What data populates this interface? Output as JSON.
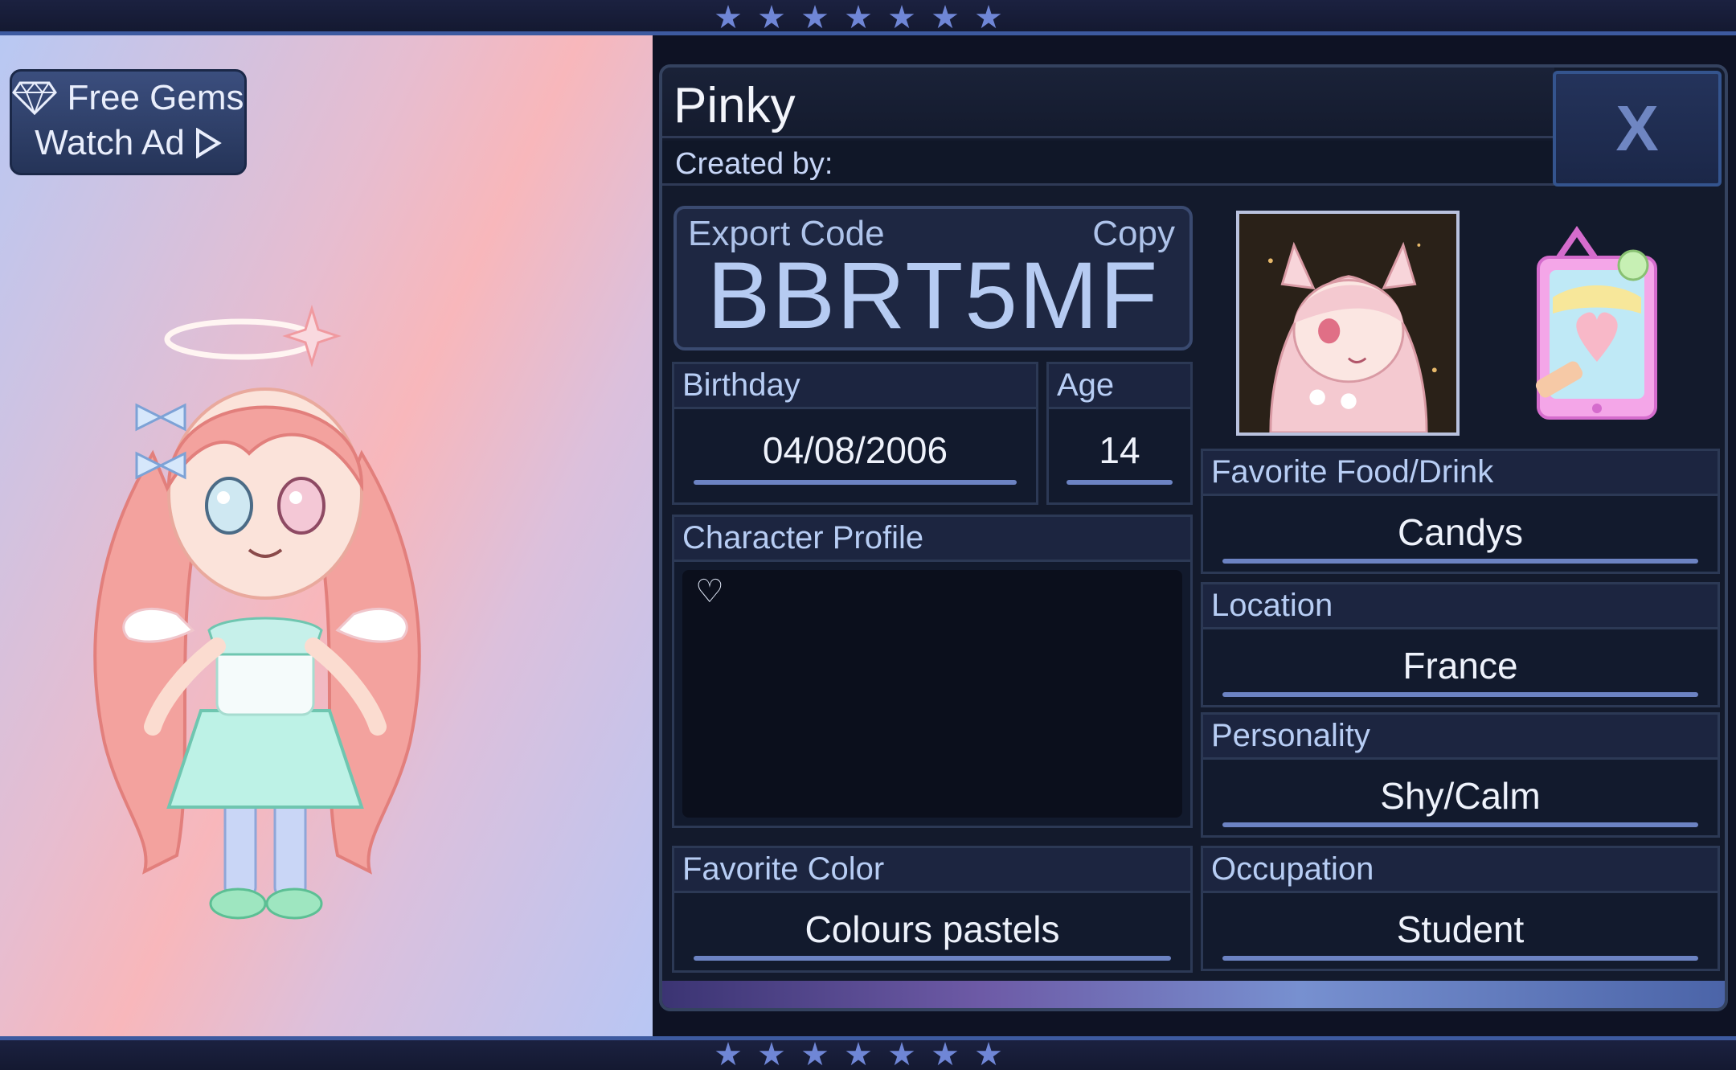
{
  "preview": {
    "free_gems_label": "Free Gems",
    "watch_ad_label": "Watch Ad"
  },
  "profile": {
    "name": "Pinky",
    "created_by_label": "Created by:",
    "close_label": "X",
    "export_code_label": "Export Code",
    "copy_label": "Copy",
    "export_code": "BBRT5MF",
    "birthday_label": "Birthday",
    "birthday": "04/08/2006",
    "age_label": "Age",
    "age": "14",
    "character_profile_label": "Character Profile",
    "character_profile_text": "♡",
    "favorite_color_label": "Favorite Color",
    "favorite_color": "Colours pastels",
    "favorite_food_label": "Favorite Food/Drink",
    "favorite_food": "Candys",
    "location_label": "Location",
    "location": "France",
    "personality_label": "Personality",
    "personality": "Shy/Calm",
    "occupation_label": "Occupation",
    "occupation": "Student"
  },
  "colors": {
    "accent": "#6c83c3",
    "panel_bg": "#131a2c",
    "label_text": "#b7cdf4"
  }
}
